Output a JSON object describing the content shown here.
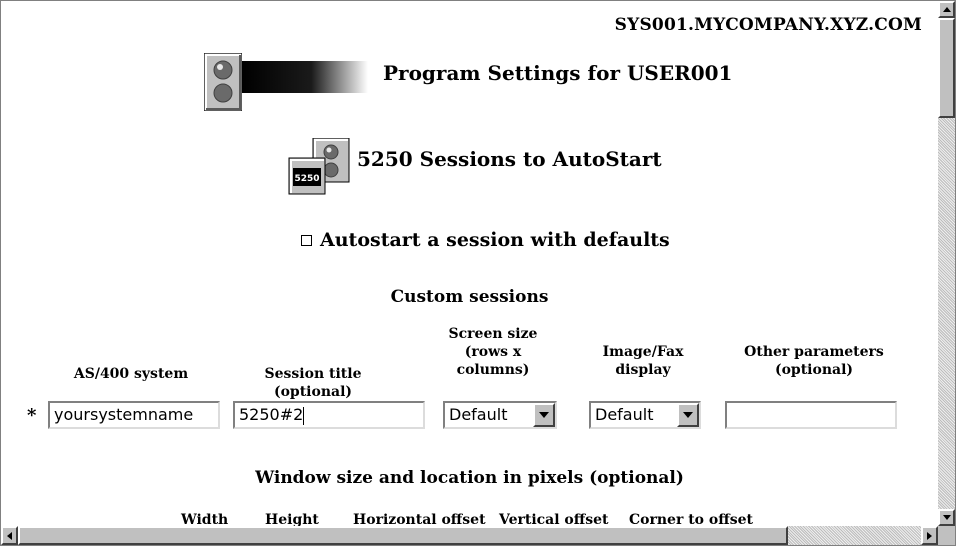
{
  "header": {
    "hostname": "SYS001.MYCOMPANY.XYZ.COM",
    "program_title": "Program Settings for USER001"
  },
  "icons": {
    "traffic_light": "traffic-light-icon",
    "session": "session-5250-icon",
    "session_badge": "5250"
  },
  "sessions": {
    "title": "5250 Sessions to AutoStart",
    "autostart_label": "Autostart a session with defaults",
    "autostart_checked": false,
    "custom_title": "Custom sessions"
  },
  "columns": {
    "as400_system": "AS/400 system",
    "session_title": "Session title (optional)",
    "screen_size_l1": "Screen size",
    "screen_size_l2": "(rows x",
    "screen_size_l3": "columns)",
    "image_fax_l1": "Image/Fax",
    "image_fax_l2": "display",
    "other_params_l1": "Other parameters",
    "other_params_l2": "(optional)"
  },
  "row": {
    "required_marker": "*",
    "system_value": "yoursystemname",
    "session_title_value": "5250#2",
    "screen_size_value": "Default",
    "image_fax_value": "Default",
    "other_params_value": ""
  },
  "window": {
    "title": "Window size and location in pixels (optional)",
    "width": "Width",
    "height": "Height",
    "horizontal_offset": "Horizontal offset",
    "vertical_offset": "Vertical offset",
    "corner_to_offset": "Corner to offset"
  }
}
